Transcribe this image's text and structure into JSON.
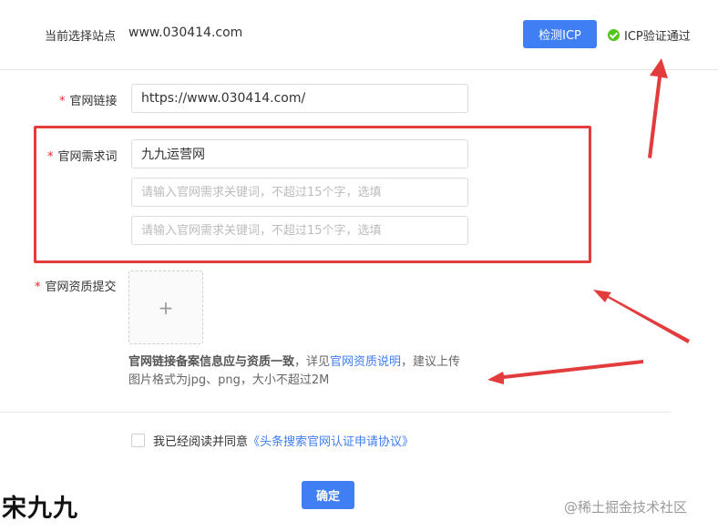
{
  "header": {
    "site_label": "当前选择站点",
    "site_value": "www.030414.com",
    "check_button": "检测ICP",
    "icp_status": "ICP验证通过"
  },
  "form": {
    "required_mark": "*",
    "link_label": "官网链接",
    "link_value": "https://www.030414.com/",
    "keywords_label": "官网需求词",
    "keyword_1_value": "九九运营网",
    "keyword_placeholder": "请输入官网需求关键词，不超过15个字，选填",
    "qualification_label": "官网资质提交",
    "upload_plus": "+",
    "hint_lead": "官网链接备案信息应与资质一致",
    "hint_mid": "，详见",
    "hint_link": "官网资质说明",
    "hint_tail": "，建议上传图片格式为jpg、png，大小不超过2M"
  },
  "agreement": {
    "text": "我已经阅读并同意",
    "link": "《头条搜索官网认证申请协议》"
  },
  "confirm_button": "确定",
  "watermarks": {
    "left": "宋九九",
    "right": "@稀土掘金技术社区"
  },
  "colors": {
    "primary": "#3f7ef3",
    "success": "#52c41a",
    "required": "#f5222d",
    "annotation": "#e23c3c"
  }
}
